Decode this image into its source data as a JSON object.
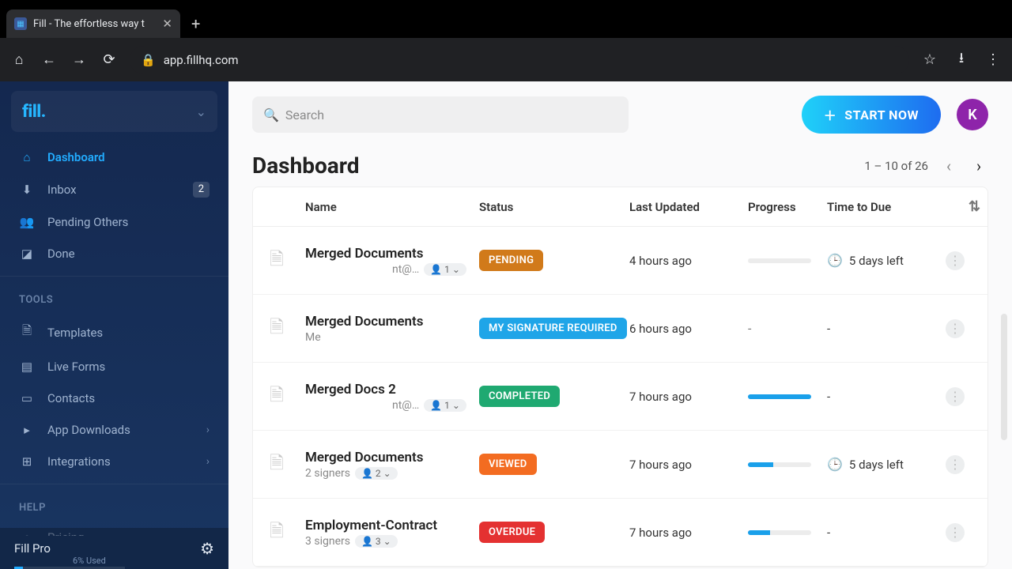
{
  "browser": {
    "tab_title": "Fill - The effortless way t",
    "url": "app.fillhq.com"
  },
  "brand": "fill.",
  "sidebar": {
    "items": [
      {
        "label": "Dashboard",
        "name": "sidebar-item-dashboard",
        "icon": "home-icon",
        "glyph": "⌂",
        "active": true
      },
      {
        "label": "Inbox",
        "name": "sidebar-item-inbox",
        "icon": "inbox-icon",
        "glyph": "⬇",
        "badge": "2"
      },
      {
        "label": "Pending Others",
        "name": "sidebar-item-pending-others",
        "icon": "users-icon",
        "glyph": "👥"
      },
      {
        "label": "Done",
        "name": "sidebar-item-done",
        "icon": "check-icon",
        "glyph": "◪"
      }
    ],
    "tools_label": "TOOLS",
    "tools": [
      {
        "label": "Templates",
        "name": "sidebar-item-templates",
        "icon": "template-icon",
        "glyph": "🗎"
      },
      {
        "label": "Live Forms",
        "name": "sidebar-item-live-forms",
        "icon": "form-icon",
        "glyph": "▤"
      },
      {
        "label": "Contacts",
        "name": "sidebar-item-contacts",
        "icon": "contacts-icon",
        "glyph": "▭"
      },
      {
        "label": "App Downloads",
        "name": "sidebar-item-app-downloads",
        "icon": "download-icon",
        "glyph": "▸",
        "arrow": true
      },
      {
        "label": "Integrations",
        "name": "sidebar-item-integrations",
        "icon": "integrations-icon",
        "glyph": "⊞",
        "arrow": true
      }
    ],
    "help_label": "HELP",
    "help": [
      {
        "label": "Pricing",
        "name": "sidebar-item-pricing",
        "icon": "pricing-icon",
        "glyph": "●"
      }
    ],
    "plan": {
      "name": "Fill Pro",
      "used": "6% Used"
    }
  },
  "search_placeholder": "Search",
  "cta": "START NOW",
  "avatar_letter": "K",
  "page": {
    "title": "Dashboard",
    "range": "1 – 10 of 26"
  },
  "columns": {
    "name": "Name",
    "status": "Status",
    "updated": "Last Updated",
    "progress": "Progress",
    "due": "Time to Due"
  },
  "rows": [
    {
      "name": "Merged Documents",
      "sub_text": "nt@…",
      "signer_chip": "1",
      "status_label": "PENDING",
      "status_class": "st-pending",
      "updated": "4 hours ago",
      "progress_pct": 0,
      "show_progress_bar": true,
      "due": "5 days left",
      "has_due_clock": true
    },
    {
      "name": "Merged Documents",
      "sub_text": "Me",
      "status_label": "MY SIGNATURE REQUIRED",
      "status_class": "st-sig",
      "updated": "6 hours ago",
      "show_progress_bar": false,
      "progress_dash": "-",
      "due_dash": "-"
    },
    {
      "name": "Merged Docs 2",
      "sub_text": "nt@…",
      "signer_chip": "1",
      "status_label": "COMPLETED",
      "status_class": "st-complete",
      "updated": "7 hours ago",
      "progress_pct": 100,
      "show_progress_bar": true,
      "due_dash": "-"
    },
    {
      "name": "Merged Documents",
      "sub_text": "2 signers",
      "signer_chip": "2",
      "status_label": "VIEWED",
      "status_class": "st-viewed",
      "updated": "7 hours ago",
      "progress_pct": 40,
      "show_progress_bar": true,
      "due": "5 days left",
      "has_due_clock": true
    },
    {
      "name": "Employment-Contract",
      "sub_text": "3 signers",
      "signer_chip": "3",
      "status_label": "OVERDUE",
      "status_class": "st-overdue",
      "updated": "7 hours ago",
      "progress_pct": 35,
      "show_progress_bar": true,
      "due_dash": "-"
    }
  ],
  "colors": {
    "brand_blue": "#22acff",
    "sidebar_bg": "#14284f",
    "pending": "#d17a1a",
    "sig_required": "#1fa5e8",
    "completed": "#1fa971",
    "viewed": "#f36c21",
    "overdue": "#e43131"
  }
}
